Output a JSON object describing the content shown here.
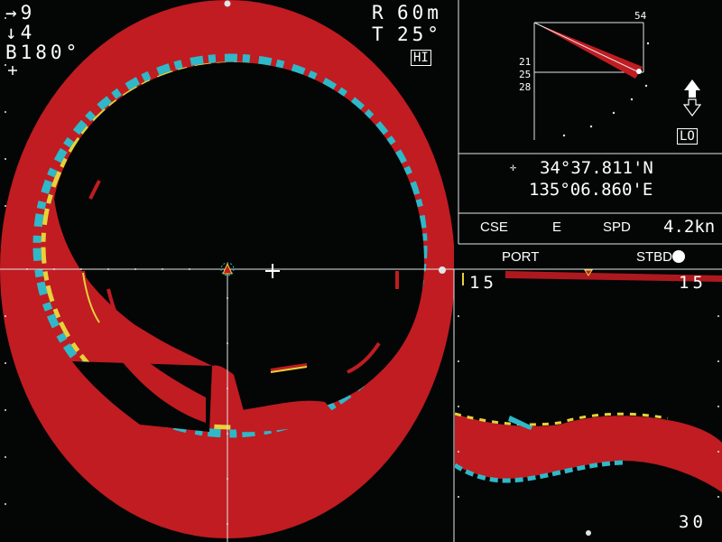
{
  "display": {
    "top_left": {
      "heading_value": "→9",
      "depth_value": "↓4",
      "bearing_value": "B180°"
    },
    "top_right": {
      "range_label": "R",
      "range_value": "60m",
      "tilt_label": "T",
      "tilt_value": "25°",
      "gain_badge": "HI"
    },
    "tilt_gauge": {
      "top_value": "54",
      "left_values": [
        "21",
        "25",
        "28"
      ],
      "mode_badge": "LO"
    },
    "position": {
      "latitude": "34°37.811'N",
      "longitude": "135°06.860'E"
    },
    "course_speed": {
      "cse_label": "CSE",
      "cse_value": "E",
      "spd_label": "SPD",
      "spd_value": "4.2kn"
    },
    "side_scan": {
      "port_label": "PORT",
      "stbd_label": "STBD",
      "depth_left": "15",
      "depth_right": "15",
      "depth_bottom": "30"
    }
  },
  "colors": {
    "background": "#040605",
    "echo_red": "#c01c22",
    "echo_yellow": "#e6d23a",
    "echo_cyan": "#2fb8c8",
    "grid": "#dfe6e6"
  },
  "icons": {
    "cursor_marker": "crosshair-icon",
    "ship_marker": "ship-triangle-icon",
    "tilt_arrow": "up-down-arrow-icon",
    "gps_marker": "crosshair-small-icon"
  }
}
